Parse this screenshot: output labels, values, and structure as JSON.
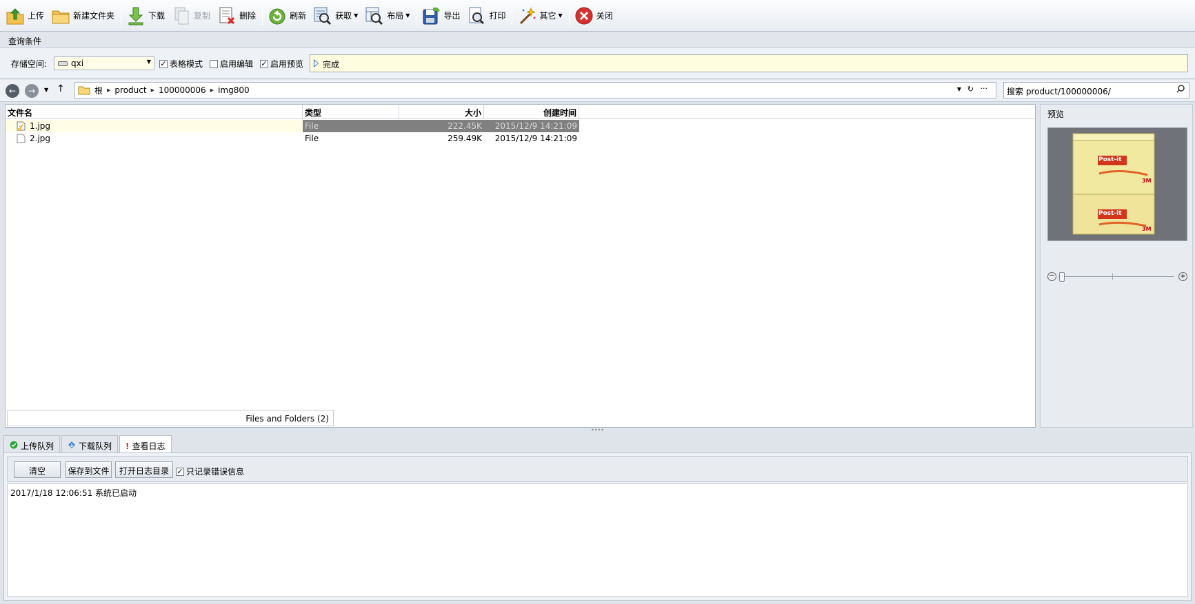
{
  "toolbar": {
    "upload": "上传",
    "new_folder": "新建文件夹",
    "download": "下载",
    "copy": "复制",
    "delete": "删除",
    "refresh": "刷新",
    "fetch": "获取",
    "layout": "布局",
    "export": "导出",
    "print": "打印",
    "other": "其它",
    "close": "关闭"
  },
  "query": {
    "group_title": "查询条件",
    "storage_label": "存储空间:",
    "storage_value": "qxi",
    "table_mode": "表格模式",
    "table_mode_checked": true,
    "enable_edit": "启用编辑",
    "enable_edit_checked": false,
    "enable_preview": "启用预览",
    "enable_preview_checked": true,
    "status": "完成"
  },
  "nav": {
    "breadcrumb": [
      "根",
      "product",
      "100000006",
      "img800"
    ],
    "search": "搜索 product/100000006/"
  },
  "filelist": {
    "columns": {
      "name": "文件名",
      "type": "类型",
      "size": "大小",
      "created": "创建时间"
    },
    "rows": [
      {
        "name": "1.jpg",
        "type": "File",
        "size": "222.45K",
        "created": "2015/12/9 14:21:09"
      },
      {
        "name": "2.jpg",
        "type": "File",
        "size": "259.49K",
        "created": "2015/12/9 14:21:09"
      }
    ],
    "footer": "Files and Folders (2)"
  },
  "preview": {
    "title": "预览",
    "brand_label": "Post-it",
    "logo_label": "3M"
  },
  "bottom": {
    "tabs": [
      "上传队列",
      "下载队列",
      "查看日志"
    ],
    "active_tab": 2,
    "buttons": {
      "clear": "清空",
      "save": "保存到文件",
      "open_dir": "打开日志目录"
    },
    "errors_only": "只记录错误信息",
    "errors_only_checked": true,
    "log_lines": [
      "2017/1/18 12:06:51 系统已启动"
    ]
  },
  "colors": {
    "accent": "#1d5fb5",
    "status_bg": "#fffde0",
    "selected_row": "#808080",
    "row_hover": "#fffde6"
  }
}
